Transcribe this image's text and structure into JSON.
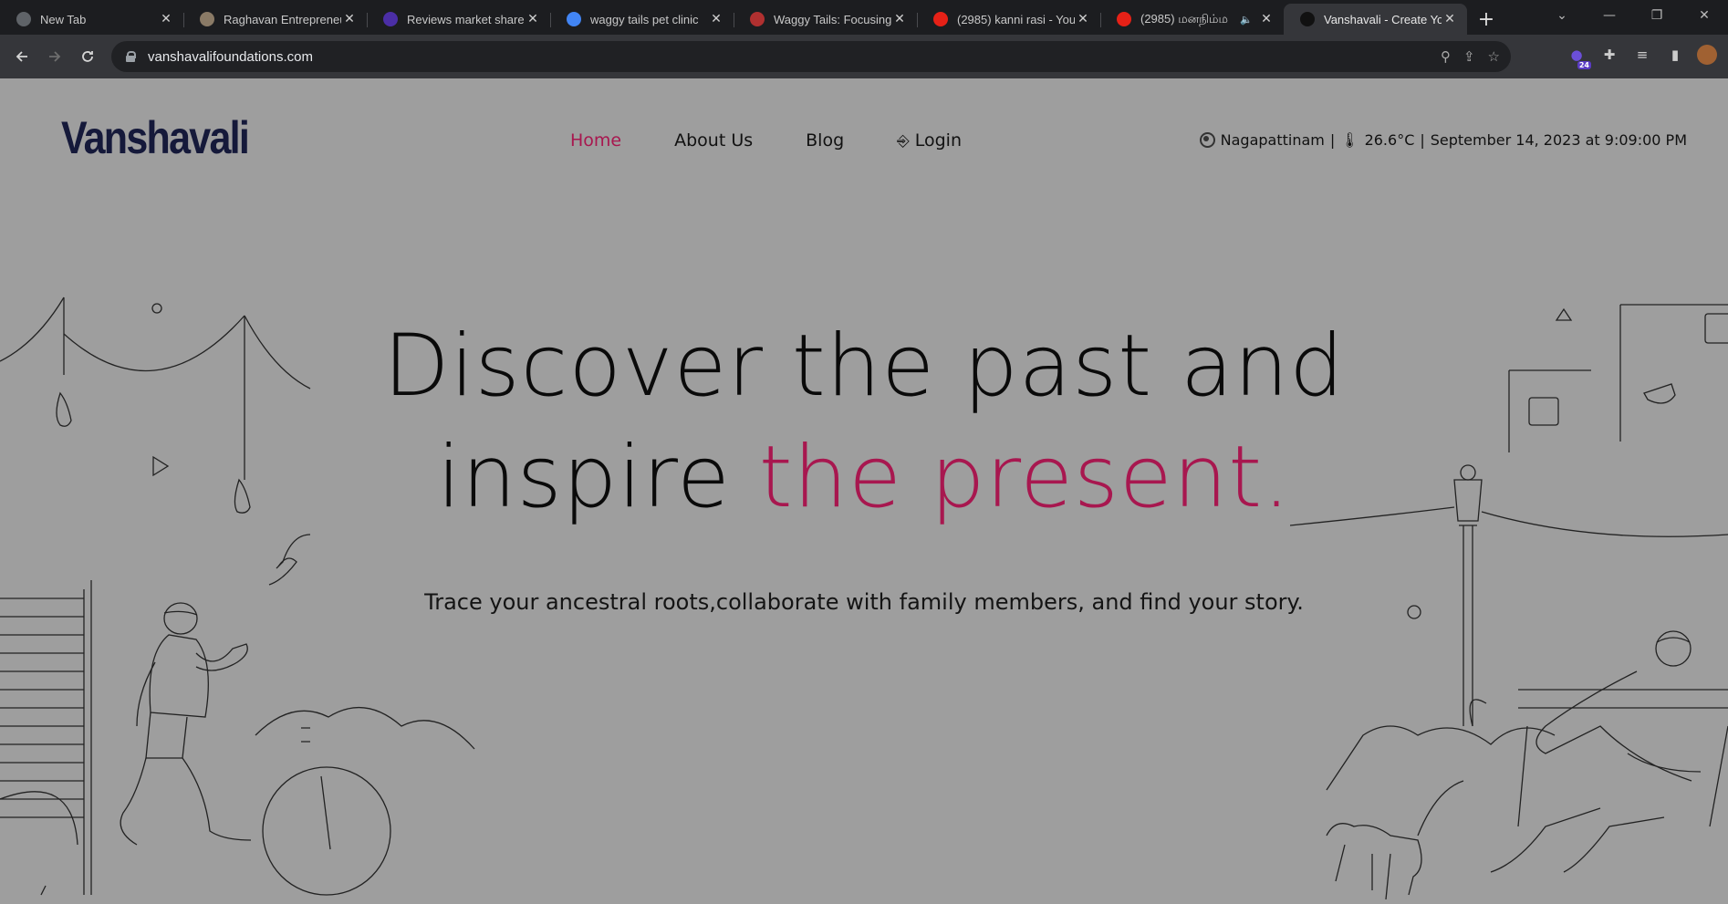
{
  "browser": {
    "tabs": [
      {
        "title": "New Tab",
        "favicon": "chrome-icon",
        "color": "#5f6368",
        "active": false
      },
      {
        "title": "Raghavan Entrepreneur",
        "favicon": "raghavan-icon",
        "color": "#8a7a66",
        "active": false
      },
      {
        "title": "Reviews market share",
        "favicon": "hexagon-icon",
        "color": "#4b2ea6",
        "active": false
      },
      {
        "title": "waggy tails pet clinic",
        "favicon": "google-icon",
        "color": "#4285f4",
        "active": false
      },
      {
        "title": "Waggy Tails: Focusing",
        "favicon": "waggy-icon",
        "color": "#b03030",
        "active": false
      },
      {
        "title": "(2985) kanni rasi - You",
        "favicon": "youtube-icon",
        "color": "#e62117",
        "active": false
      },
      {
        "title": "(2985) மனநிம்ம",
        "favicon": "youtube-icon",
        "color": "#e62117",
        "active": false,
        "audio": "🔈"
      },
      {
        "title": "Vanshavali - Create Yo",
        "favicon": "vanshavali-icon",
        "color": "#111111",
        "active": true
      }
    ],
    "new_tab_symbol": "+",
    "url": "vanshavalifoundations.com",
    "extension_badge": "24"
  },
  "site": {
    "logo": "Vanshavali",
    "nav": {
      "home": "Home",
      "about": "About Us",
      "blog": "Blog",
      "login": "Login"
    },
    "info": {
      "location": "Nagapattinam",
      "temperature": "26.6°C",
      "datetime": "September 14, 2023 at 9:09:00 PM",
      "separator": "|"
    },
    "hero": {
      "line1": "Discover the past and",
      "line2_plain": "inspire ",
      "line2_accent": "the present.",
      "subtitle": "Trace your ancestral roots,collaborate with family members, and find your story."
    },
    "colors": {
      "accent": "#a8174f",
      "background": "#9e9e9e",
      "logo": "#15193a"
    }
  }
}
